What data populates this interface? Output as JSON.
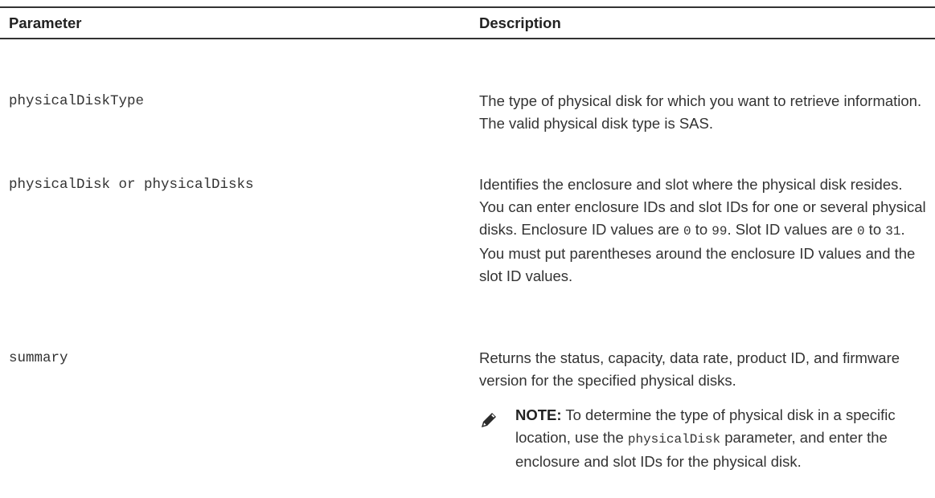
{
  "table": {
    "headers": {
      "parameter": "Parameter",
      "description": "Description"
    },
    "rows": [
      {
        "parameter": "physicalDiskType",
        "description": "The type of physical disk for which you want to retrieve information. The valid physical disk type is SAS."
      },
      {
        "parameter": "physicalDisk or physicalDisks",
        "description_parts": {
          "p1": "Identifies the enclosure and slot where the physical disk resides. You can enter enclosure IDs and slot IDs for one or several physical disks. Enclosure ID values are ",
          "c1": "0",
          "p2": " to ",
          "c2": "99",
          "p3": ". Slot ID values are ",
          "c3": "0",
          "p4": " to ",
          "c4": "31",
          "p5": ". You must put parentheses around the enclosure ID values and the slot ID values."
        }
      },
      {
        "parameter": "summary",
        "description": "Returns the status, capacity, data rate, product ID, and firmware version for the specified physical disks."
      }
    ],
    "note": {
      "icon": "pencil-note-icon",
      "label": "NOTE:",
      "text_before": " To determine the type of physical disk in a specific location, use the ",
      "code": "physicalDisk",
      "text_after": " parameter, and enter the enclosure and slot IDs for the physical disk."
    }
  }
}
